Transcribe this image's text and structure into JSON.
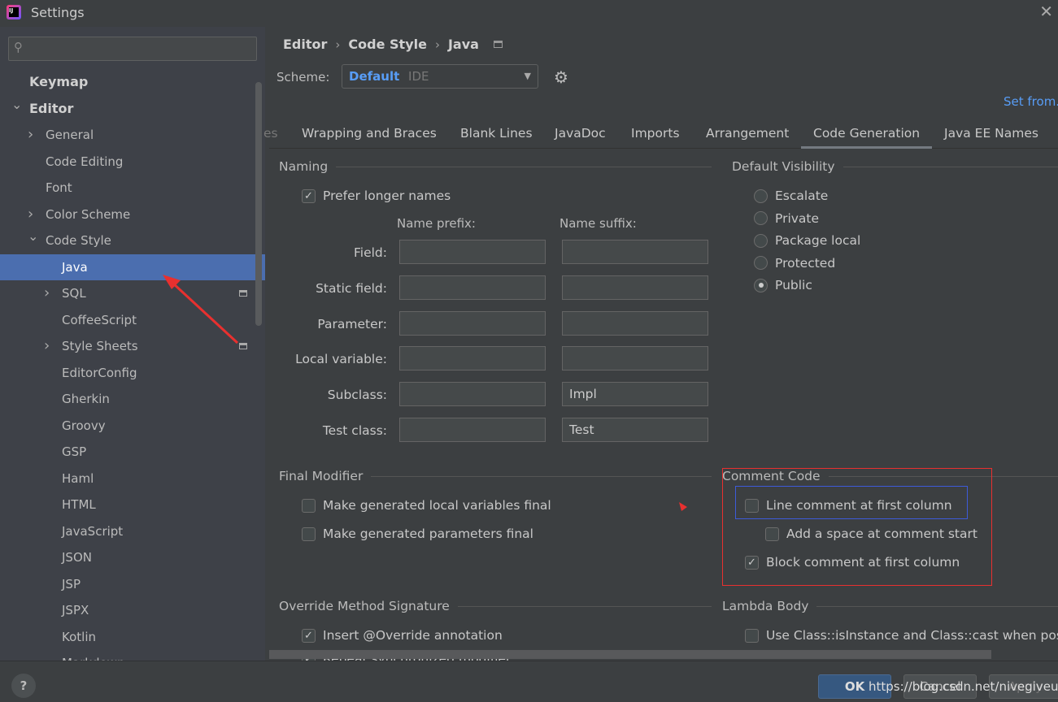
{
  "window": {
    "title": "Settings",
    "app_icon": "intellij-icon"
  },
  "sidebar": {
    "search_placeholder": "",
    "items": [
      {
        "label": "Keymap",
        "level": 0,
        "bold": true
      },
      {
        "label": "Editor",
        "level": 0,
        "bold": true,
        "expanded": true
      },
      {
        "label": "General",
        "level": 1,
        "collapsed": true
      },
      {
        "label": "Code Editing",
        "level": 1
      },
      {
        "label": "Font",
        "level": 1
      },
      {
        "label": "Color Scheme",
        "level": 1,
        "collapsed": true
      },
      {
        "label": "Code Style",
        "level": 1,
        "expanded": true
      },
      {
        "label": "Java",
        "level": 2,
        "selected": true
      },
      {
        "label": "SQL",
        "level": 2,
        "collapsed": true,
        "badge": true
      },
      {
        "label": "CoffeeScript",
        "level": 2
      },
      {
        "label": "Style Sheets",
        "level": 2,
        "collapsed": true,
        "badge": true
      },
      {
        "label": "EditorConfig",
        "level": 2
      },
      {
        "label": "Gherkin",
        "level": 2
      },
      {
        "label": "Groovy",
        "level": 2
      },
      {
        "label": "GSP",
        "level": 2
      },
      {
        "label": "Haml",
        "level": 2
      },
      {
        "label": "HTML",
        "level": 2
      },
      {
        "label": "JavaScript",
        "level": 2
      },
      {
        "label": "JSON",
        "level": 2
      },
      {
        "label": "JSP",
        "level": 2
      },
      {
        "label": "JSPX",
        "level": 2
      },
      {
        "label": "Kotlin",
        "level": 2
      },
      {
        "label": "Markdown",
        "level": 2
      }
    ]
  },
  "header": {
    "breadcrumb": [
      "Editor",
      "Code Style",
      "Java"
    ],
    "scheme_label": "Scheme:",
    "scheme_name": "Default",
    "scheme_type": "IDE",
    "set_from": "Set from..."
  },
  "tabs": {
    "items": [
      "es",
      "Wrapping and Braces",
      "Blank Lines",
      "JavaDoc",
      "Imports",
      "Arrangement",
      "Code Generation",
      "Java EE Names"
    ],
    "active": "Code Generation"
  },
  "naming": {
    "title": "Naming",
    "prefer_longer": "Prefer longer names",
    "prefer_longer_checked": true,
    "prefix_header": "Name prefix:",
    "suffix_header": "Name suffix:",
    "rows": [
      {
        "label": "Field:",
        "prefix": "",
        "suffix": ""
      },
      {
        "label": "Static field:",
        "prefix": "",
        "suffix": ""
      },
      {
        "label": "Parameter:",
        "prefix": "",
        "suffix": ""
      },
      {
        "label": "Local variable:",
        "prefix": "",
        "suffix": ""
      },
      {
        "label": "Subclass:",
        "prefix": "",
        "suffix": "Impl"
      },
      {
        "label": "Test class:",
        "prefix": "",
        "suffix": "Test"
      }
    ]
  },
  "visibility": {
    "title": "Default Visibility",
    "options": [
      "Escalate",
      "Private",
      "Package local",
      "Protected",
      "Public"
    ],
    "selected": "Public"
  },
  "final_modifier": {
    "title": "Final Modifier",
    "options": [
      {
        "label": "Make generated local variables final",
        "checked": false
      },
      {
        "label": "Make generated parameters final",
        "checked": false
      }
    ]
  },
  "comment_code": {
    "title": "Comment Code",
    "options": [
      {
        "label": "Line comment at first column",
        "checked": false
      },
      {
        "label": "Add a space at comment start",
        "checked": false
      },
      {
        "label": "Block comment at first column",
        "checked": true
      }
    ]
  },
  "override": {
    "title": "Override Method Signature",
    "options": [
      {
        "label": "Insert @Override annotation",
        "checked": true
      },
      {
        "label": "Repeat synchronized modifier",
        "checked": true
      }
    ]
  },
  "lambda": {
    "title": "Lambda Body",
    "options": [
      {
        "label": "Use Class::isInstance and Class::cast when possible",
        "checked": false
      }
    ]
  },
  "footer": {
    "ok": "OK",
    "cancel": "Cancel",
    "apply": "Apply",
    "watermark": "https://blog.csdn.net/nivegiveup"
  },
  "colors": {
    "accent": "#4b6eaf",
    "link": "#589df6",
    "annotation_red": "#e8302f",
    "annotation_blue": "#3d5bd9"
  }
}
